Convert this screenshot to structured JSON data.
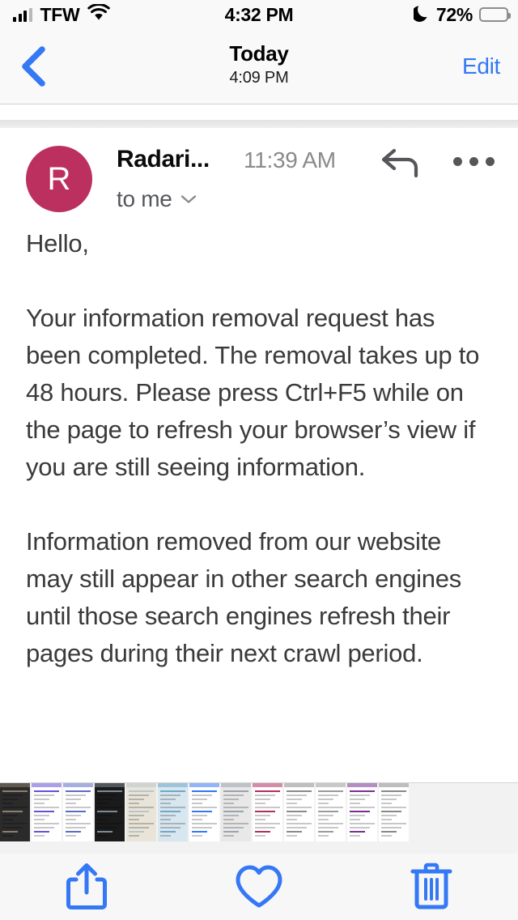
{
  "status_bar": {
    "carrier": "TFW",
    "time": "4:32 PM",
    "battery_percent": "72%",
    "battery_level": 72,
    "wifi_icon": "wifi-icon",
    "signal_icon": "cellular-signal-icon",
    "dnd_icon": "moon-icon"
  },
  "nav_bar": {
    "back_icon": "chevron-left-icon",
    "title": "Today",
    "subtitle": "4:09 PM",
    "edit_label": "Edit"
  },
  "message": {
    "avatar_initial": "R",
    "avatar_color": "#bc3060",
    "sender": "Radari...",
    "time": "11:39 AM",
    "recipients": "to me",
    "recipients_chevron_icon": "chevron-down-icon",
    "reply_icon": "reply-arrow-icon",
    "more_icon": "ellipsis-icon",
    "body_paragraphs": [
      "Hello,",
      "Your information removal request has been completed. The removal takes up to 48 hours. Please press Ctrl+F5 while on the page to refresh your browser’s view if you are still seeing information.",
      "Information removed from our website may still appear in other search engines until those search engines refresh their pages during their next crawl period."
    ]
  },
  "thumbnail_strip": {
    "count": 13,
    "label": "screenshot-thumbnails"
  },
  "toolbar": {
    "share_icon": "share-icon",
    "flag_icon": "heart-icon",
    "trash_icon": "trash-icon",
    "tint": "#3478f6"
  }
}
